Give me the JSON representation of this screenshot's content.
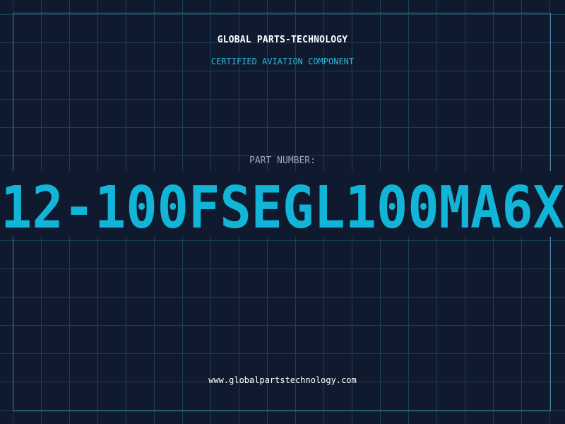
{
  "header": {
    "company": "GLOBAL PARTS-TECHNOLOGY",
    "tagline": "CERTIFIED AVIATION COMPONENT"
  },
  "part": {
    "label": "PART NUMBER:",
    "number": "12-100FSEGL100MA6X"
  },
  "footer": {
    "website": "www.globalpartstechnology.com"
  },
  "colors": {
    "background": "#101a2e",
    "grid": "#1d3f56",
    "frame": "#3e7f9a",
    "accent": "#12b4d8",
    "subtitle": "#2fb4dc",
    "label": "#98a6b8",
    "text": "#ffffff"
  }
}
